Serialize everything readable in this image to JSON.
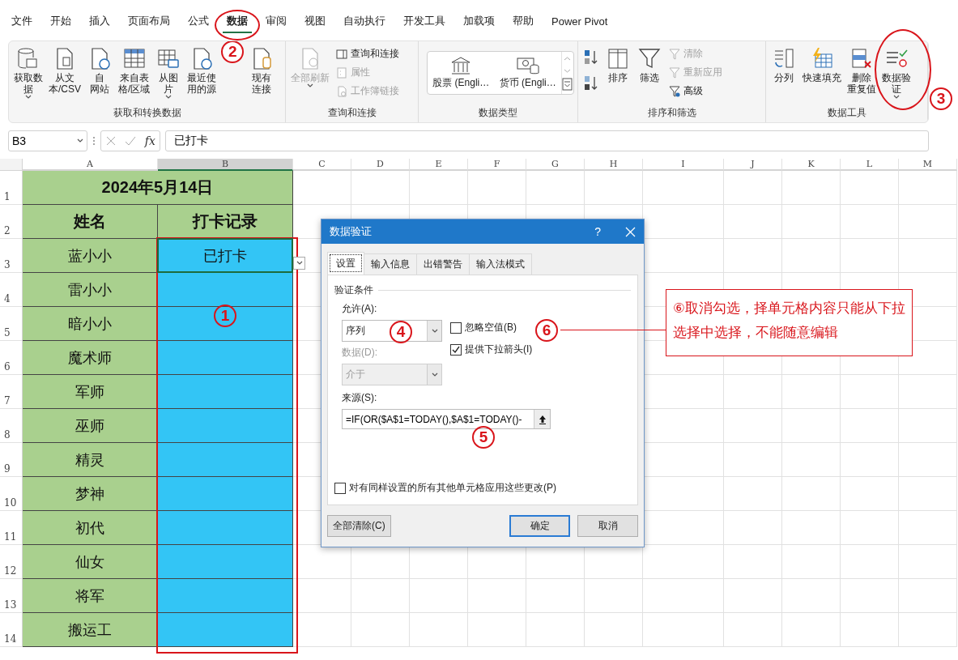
{
  "menu_tabs": [
    {
      "label": "文件",
      "selected": false
    },
    {
      "label": "开始",
      "selected": false
    },
    {
      "label": "插入",
      "selected": false
    },
    {
      "label": "页面布局",
      "selected": false
    },
    {
      "label": "公式",
      "selected": false
    },
    {
      "label": "数据",
      "selected": true
    },
    {
      "label": "审阅",
      "selected": false
    },
    {
      "label": "视图",
      "selected": false
    },
    {
      "label": "自动执行",
      "selected": false
    },
    {
      "label": "开发工具",
      "selected": false
    },
    {
      "label": "加载项",
      "selected": false
    },
    {
      "label": "帮助",
      "selected": false
    },
    {
      "label": "Power Pivot",
      "selected": false
    }
  ],
  "ribbon_groups": [
    {
      "label": "获取和转换数据",
      "items": [
        {
          "kind": "large",
          "lines": [
            "获取数",
            "据"
          ],
          "dropdown": true,
          "disabled": false
        },
        {
          "kind": "large",
          "lines": [
            "从文",
            "本/CSV"
          ],
          "dropdown": false,
          "disabled": false
        },
        {
          "kind": "large",
          "lines": [
            "自",
            "网站"
          ],
          "dropdown": false,
          "disabled": false
        },
        {
          "kind": "large",
          "lines": [
            "来自表",
            "格/区域"
          ],
          "dropdown": false,
          "disabled": false
        },
        {
          "kind": "large",
          "lines": [
            "从图",
            "片"
          ],
          "dropdown": true,
          "disabled": false
        },
        {
          "kind": "large",
          "lines": [
            "最近使",
            "用的源"
          ],
          "dropdown": false,
          "disabled": false
        },
        {
          "kind": "large",
          "lines": [
            "现有",
            "连接"
          ],
          "dropdown": false,
          "disabled": false
        }
      ]
    },
    {
      "label": "查询和连接",
      "items": [
        {
          "kind": "large",
          "lines": [
            "全部刷新"
          ],
          "dropdown": true,
          "disabled": true
        },
        {
          "kind": "small",
          "lines": [
            "查询和连接"
          ],
          "dropdown": false,
          "disabled": false
        },
        {
          "kind": "small",
          "lines": [
            "属性"
          ],
          "dropdown": false,
          "disabled": true
        },
        {
          "kind": "small",
          "lines": [
            "工作簿链接"
          ],
          "dropdown": false,
          "disabled": true
        }
      ]
    },
    {
      "label": "数据类型",
      "items": [
        {
          "kind": "gallery",
          "lines": [
            "股票 (Engli…"
          ],
          "dropdown": false,
          "disabled": false
        },
        {
          "kind": "gallery",
          "lines": [
            "货币 (Engli…"
          ],
          "dropdown": false,
          "disabled": false
        }
      ]
    },
    {
      "label": "排序和筛选",
      "items": [
        {
          "kind": "icon",
          "dropdown": false,
          "disabled": false
        },
        {
          "kind": "icon",
          "dropdown": false,
          "disabled": false
        },
        {
          "kind": "large",
          "lines": [
            "排序"
          ],
          "dropdown": false,
          "disabled": false
        },
        {
          "kind": "large",
          "lines": [
            "筛选"
          ],
          "dropdown": false,
          "disabled": false
        },
        {
          "kind": "small",
          "lines": [
            "清除"
          ],
          "dropdown": false,
          "disabled": true
        },
        {
          "kind": "small",
          "lines": [
            "重新应用"
          ],
          "dropdown": false,
          "disabled": true
        },
        {
          "kind": "small",
          "lines": [
            "高级"
          ],
          "dropdown": false,
          "disabled": false
        }
      ]
    },
    {
      "label": "数据工具",
      "items": [
        {
          "kind": "large",
          "lines": [
            "分列"
          ],
          "dropdown": false,
          "disabled": false
        },
        {
          "kind": "large",
          "lines": [
            "快速填充"
          ],
          "dropdown": false,
          "disabled": false
        },
        {
          "kind": "large",
          "lines": [
            "删除",
            "重复值"
          ],
          "dropdown": false,
          "disabled": false
        },
        {
          "kind": "large",
          "lines": [
            "数据验",
            "证"
          ],
          "dropdown": true,
          "disabled": false
        }
      ]
    }
  ],
  "formula_bar": {
    "name_box": "B3",
    "function_symbol": "fx",
    "formula": "已打卡"
  },
  "columns": [
    {
      "label": "A",
      "selected": false
    },
    {
      "label": "B",
      "selected": true
    },
    {
      "label": "C",
      "selected": false
    },
    {
      "label": "D",
      "selected": false
    },
    {
      "label": "E",
      "selected": false
    },
    {
      "label": "F",
      "selected": false
    },
    {
      "label": "G",
      "selected": false
    },
    {
      "label": "H",
      "selected": false
    },
    {
      "label": "I",
      "selected": false
    },
    {
      "label": "J",
      "selected": false
    },
    {
      "label": "K",
      "selected": false
    },
    {
      "label": "L",
      "selected": false
    },
    {
      "label": "M",
      "selected": false
    }
  ],
  "rows": [
    {
      "number": "1",
      "kind": "title",
      "text": "2024年5月14日"
    },
    {
      "number": "2",
      "kind": "header",
      "cells": [
        "姓名",
        "打卡记录"
      ]
    },
    {
      "number": "3",
      "kind": "data",
      "name": "蓝小小",
      "record": "已打卡",
      "selected": true
    },
    {
      "number": "4",
      "kind": "data",
      "name": "雷小小",
      "selected": false
    },
    {
      "number": "5",
      "kind": "data",
      "name": "暗小小",
      "selected": false
    },
    {
      "number": "6",
      "kind": "data",
      "name": "魔术师",
      "selected": false
    },
    {
      "number": "7",
      "kind": "data",
      "name": "军师",
      "selected": false
    },
    {
      "number": "8",
      "kind": "data",
      "name": "巫师",
      "selected": false
    },
    {
      "number": "9",
      "kind": "data",
      "name": "精灵",
      "selected": false
    },
    {
      "number": "10",
      "kind": "data",
      "name": "梦神",
      "selected": false
    },
    {
      "number": "11",
      "kind": "data",
      "name": "初代",
      "selected": false
    },
    {
      "number": "12",
      "kind": "data",
      "name": "仙女",
      "selected": false
    },
    {
      "number": "13",
      "kind": "data",
      "name": "将军",
      "selected": false
    },
    {
      "number": "14",
      "kind": "data",
      "name": "搬运工",
      "selected": false
    }
  ],
  "dialog": {
    "title": "数据验证",
    "help": "?",
    "tabs": [
      {
        "label": "设置",
        "selected": true
      },
      {
        "label": "输入信息",
        "selected": false
      },
      {
        "label": "出错警告",
        "selected": false
      },
      {
        "label": "输入法模式",
        "selected": false
      }
    ],
    "section": "验证条件",
    "allow": {
      "label": "允许(A):",
      "value": "序列",
      "disabled": false
    },
    "data": {
      "label": "数据(D):",
      "value": "介于",
      "disabled": true
    },
    "checkboxes": [
      {
        "label": "忽略空值(B)",
        "checked": false
      },
      {
        "label": "提供下拉箭头(I)",
        "checked": true
      }
    ],
    "source": {
      "label": "来源(S):",
      "value": "=IF(OR($A$1=TODAY(),$A$1=TODAY()-"
    },
    "apply_all": {
      "label": "对有同样设置的所有其他单元格应用这些更改(P)",
      "checked": false
    },
    "buttons": [
      {
        "label": "全部清除(C)",
        "default": false
      },
      {
        "label": "确定",
        "default": true
      },
      {
        "label": "取消",
        "default": false
      }
    ]
  },
  "markers": [
    "1",
    "2",
    "3",
    "4",
    "5",
    "6"
  ],
  "callout": "⑥取消勾选，择单元格内容只能从下拉选择中选择，不能随意编辑"
}
